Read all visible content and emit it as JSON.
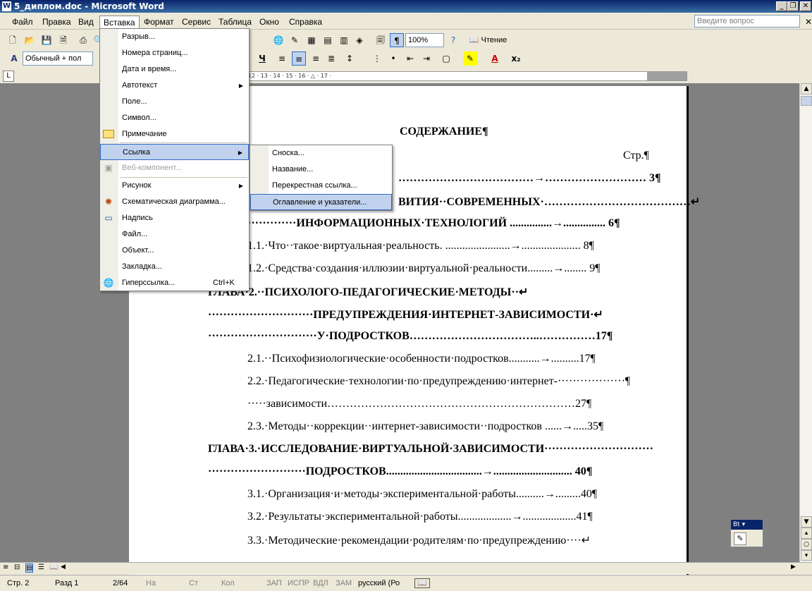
{
  "window": {
    "title": "5_диплом.doc - Microsoft Word",
    "buttons": {
      "minimize": "_",
      "maximize": "❐",
      "close": "✕"
    }
  },
  "menubar": {
    "items": [
      "Файл",
      "Правка",
      "Вид",
      "Вставка",
      "Формат",
      "Сервис",
      "Таблица",
      "Окно",
      "Справка"
    ],
    "help_placeholder": "Введите вопрос",
    "close_doc": "✕"
  },
  "toolbar": {
    "zoom": "100%",
    "read_label": "Чтение",
    "style": "Обычный + пол",
    "underline_label": "Ч"
  },
  "insert_menu": {
    "items": [
      {
        "label": "Разрыв...",
        "icon": ""
      },
      {
        "label": "Номера страниц...",
        "icon": ""
      },
      {
        "label": "Дата и время...",
        "icon": ""
      },
      {
        "label": "Автотекст",
        "icon": "",
        "submenu": true
      },
      {
        "label": "Поле...",
        "icon": ""
      },
      {
        "label": "Символ...",
        "icon": ""
      },
      {
        "label": "Примечание",
        "icon": "comment-icon"
      },
      {
        "label": "Ссылка",
        "icon": "",
        "submenu": true,
        "highlighted": true
      },
      {
        "label": "Веб-компонент...",
        "icon": "web-component-icon",
        "disabled": true
      },
      {
        "label": "Рисунок",
        "icon": "",
        "submenu": true
      },
      {
        "label": "Схематическая диаграмма...",
        "icon": "diagram-icon"
      },
      {
        "label": "Надпись",
        "icon": "textbox-icon"
      },
      {
        "label": "Файл...",
        "icon": ""
      },
      {
        "label": "Объект...",
        "icon": ""
      },
      {
        "label": "Закладка...",
        "icon": ""
      },
      {
        "label": "Гиперссылка...",
        "icon": "hyperlink-icon",
        "shortcut": "Ctrl+K"
      }
    ]
  },
  "reference_submenu": {
    "items": [
      {
        "label": "Сноска..."
      },
      {
        "label": "Название..."
      },
      {
        "label": "Перекрестная ссылка..."
      },
      {
        "label": "Оглавление и указатели...",
        "highlighted": true
      }
    ]
  },
  "document": {
    "heading": "СОДЕРЖАНИЕ¶",
    "page_col": "Стр.¶",
    "lines": [
      {
        "text": "………………………………→……………………… 3¶",
        "bold": true
      },
      {
        "text": "ВИТИЯ··СОВРЕМЕННЫХ·…………………………………↵",
        "bold": true
      },
      {
        "text": "·············ИНФОРМАЦИОННЫХ·ТЕХНОЛОГИЙ ...............→............... 6¶",
        "bold": true
      },
      {
        "text": "1.1.·Что··такое·виртуальная·реальность. .......................→..................... 8¶",
        "bold": false
      },
      {
        "text": "1.2.·Средства·создания·иллюзии·виртуальной·реальности.........→........ 9¶",
        "bold": false
      },
      {
        "text": "ГЛАВА·2.··ПСИХОЛОГО-ПЕДАГОГИЧЕСКИЕ·МЕТОДЫ··↵",
        "bold": true
      },
      {
        "text": "····························ПРЕДУПРЕЖДЕНИЯ·ИНТЕРНЕТ-ЗАВИСИМОСТИ·↵",
        "bold": true
      },
      {
        "text": "·····························У·ПОДРОСТКОВ……………………………..……………17¶",
        "bold": true
      },
      {
        "text": "2.1.··Психофизиологические·особенности·подростков...........→..........17¶",
        "bold": false
      },
      {
        "text": "2.2.·Педагогические·технологии·по·предупреждению·интернет-··················¶",
        "bold": false
      },
      {
        "text": "·····зависимости…………………………………………………………27¶",
        "bold": false
      },
      {
        "text": "2.3.·Методы··коррекции··интернет-зависимости··подростков ......→.....35¶",
        "bold": false
      },
      {
        "text": "ГЛАВА·3.·ИССЛЕДОВАНИЕ·ВИРТУАЛЬНОЙ·ЗАВИСИМОСТИ·····························",
        "bold": true
      },
      {
        "text": "··························ПОДРОСТКОВ..................................→............................ 40¶",
        "bold": true
      },
      {
        "text": "3.1.·Организация·и·методы·экспериментальной·работы..........→.........40¶",
        "bold": false
      },
      {
        "text": "3.2.·Результаты·экспериментальной·работы...................→...................41¶",
        "bold": false
      },
      {
        "text": "3.3.·Методические·рекомендации·родителям·по·предупреждению····↵",
        "bold": false
      }
    ]
  },
  "ruler": {
    "marks": "· 2 · 1 · 2 · 3 · 4 · 5 · 6 · 7 · 8 · 9 · 10 · 11 · 12 · 13 · 14 · 15 · 16 · △ · 17 ·"
  },
  "statusbar": {
    "page": "Стр. 2",
    "section": "Разд 1",
    "pages": "2/64",
    "at": "На",
    "line": "Ст",
    "col": "Кол",
    "rec": "ЗАП",
    "trk": "ИСПР",
    "ext": "ВДЛ",
    "ovr": "ЗАМ",
    "lang": "русский (Ро"
  },
  "floatbar": {
    "title": "Вt ▾"
  }
}
